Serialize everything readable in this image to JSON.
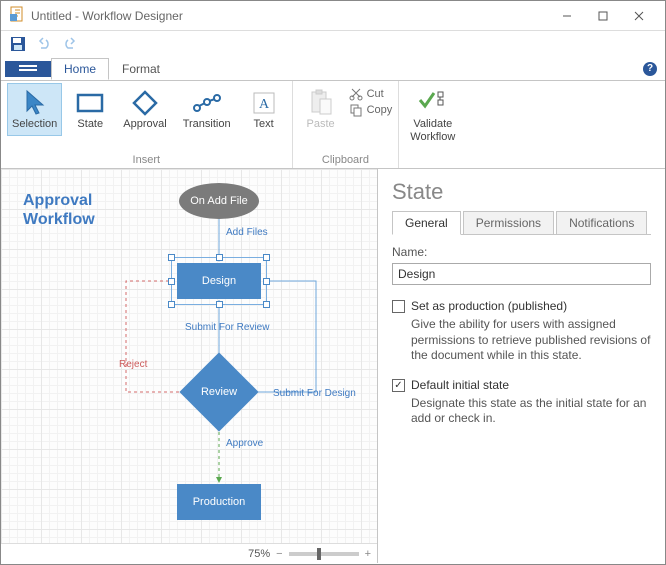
{
  "window": {
    "title": "Untitled - Workflow Designer"
  },
  "tabs": {
    "file": "",
    "home": "Home",
    "format": "Format"
  },
  "ribbon": {
    "insert_label": "Insert",
    "clipboard_label": "Clipboard",
    "selection": "Selection",
    "state": "State",
    "approval": "Approval",
    "transition": "Transition",
    "text": "Text",
    "paste": "Paste",
    "cut": "Cut",
    "copy": "Copy",
    "validate": "Validate\nWorkflow"
  },
  "canvas": {
    "title": "Approval\nWorkflow",
    "nodes": {
      "start": "On Add File",
      "design": "Design",
      "review": "Review",
      "production": "Production"
    },
    "edges": {
      "add_files": "Add Files",
      "submit_review": "Submit For Review",
      "reject": "Reject",
      "submit_design": "Submit For Design",
      "approve": "Approve"
    },
    "zoom": "75%"
  },
  "panel": {
    "title": "State",
    "tabs": {
      "general": "General",
      "permissions": "Permissions",
      "notifications": "Notifications"
    },
    "name_label": "Name:",
    "name_value": "Design",
    "prod_check": "Set as production (published)",
    "prod_desc": "Give the ability for users with assigned permissions to retrieve published revisions of the document while in this state.",
    "init_check": "Default initial state",
    "init_desc": "Designate this state as the initial state for an add or check in."
  }
}
